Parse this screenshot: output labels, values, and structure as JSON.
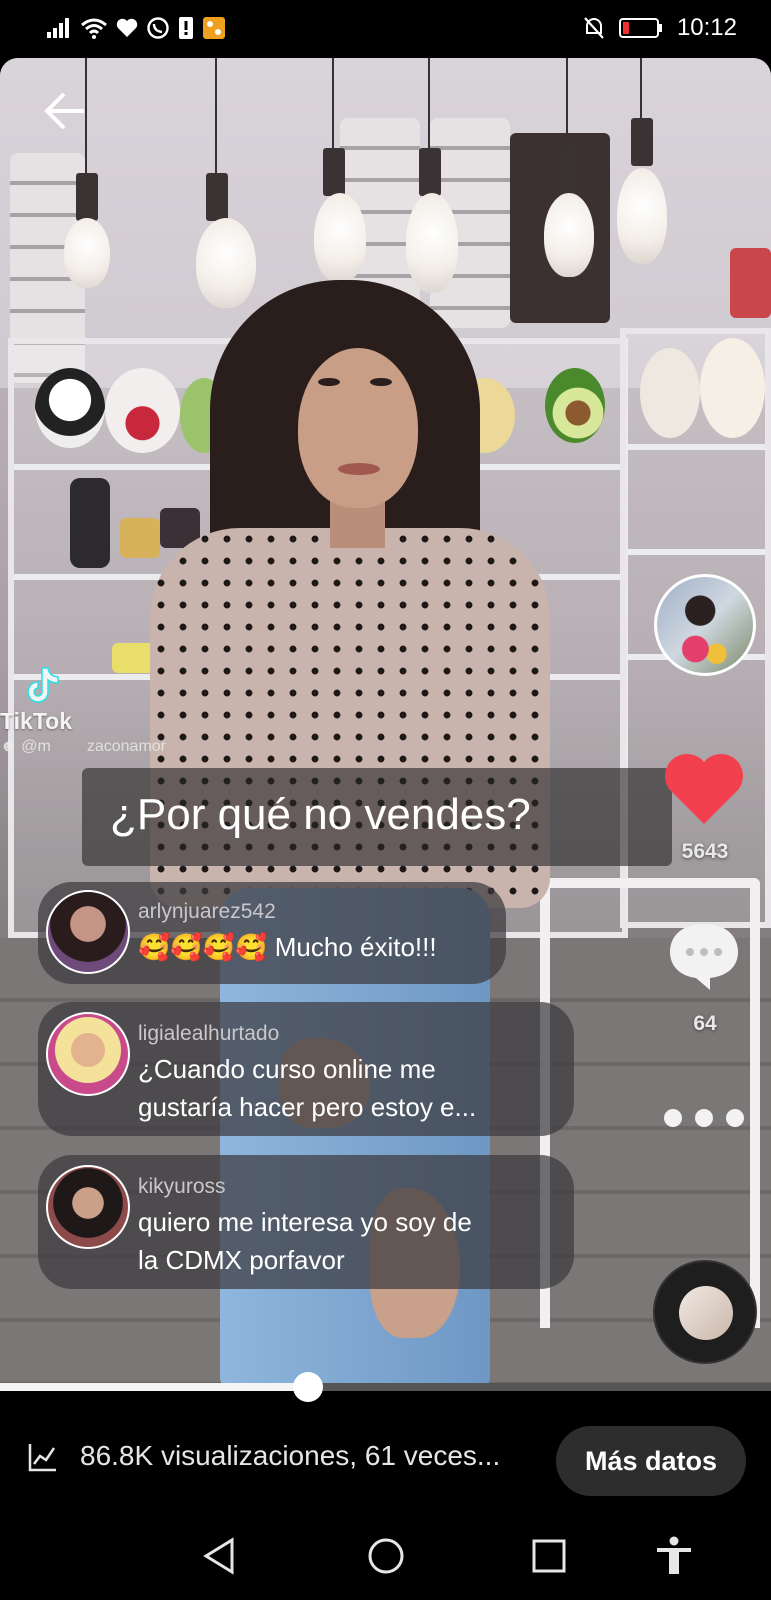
{
  "status_bar": {
    "time": "10:12",
    "left_icons": [
      "signal-icon",
      "wifi-icon",
      "heart-icon",
      "whatsapp-icon",
      "alert-icon",
      "app-icon"
    ],
    "right_icons": [
      "mute-icon",
      "battery-low-icon"
    ]
  },
  "video": {
    "watermark_brand": "TikTok",
    "watermark_handle": "@m",
    "watermark_handle_rest": "zaconamor",
    "caption": "¿Por qué no vendes?",
    "likes": "5643",
    "comments_count": "64"
  },
  "comments": [
    {
      "username": "arlynjuarez542",
      "emoji": "🥰🥰🥰🥰",
      "text": "Mucho éxito!!!"
    },
    {
      "username": "ligialealhurtado",
      "text_line1": "¿Cuando curso online me",
      "text_line2": "gustaría hacer pero estoy e..."
    },
    {
      "username": "kikyuross",
      "text_line1": "quiero me interesa yo soy de",
      "text_line2": "la CDMX porfavor"
    }
  ],
  "progress": {
    "fraction": 0.4
  },
  "stats": {
    "text": "86.8K visualizaciones, 61 veces...",
    "more_button": "Más datos"
  },
  "colors": {
    "like_red": "#f3404f",
    "background": "#000000"
  }
}
